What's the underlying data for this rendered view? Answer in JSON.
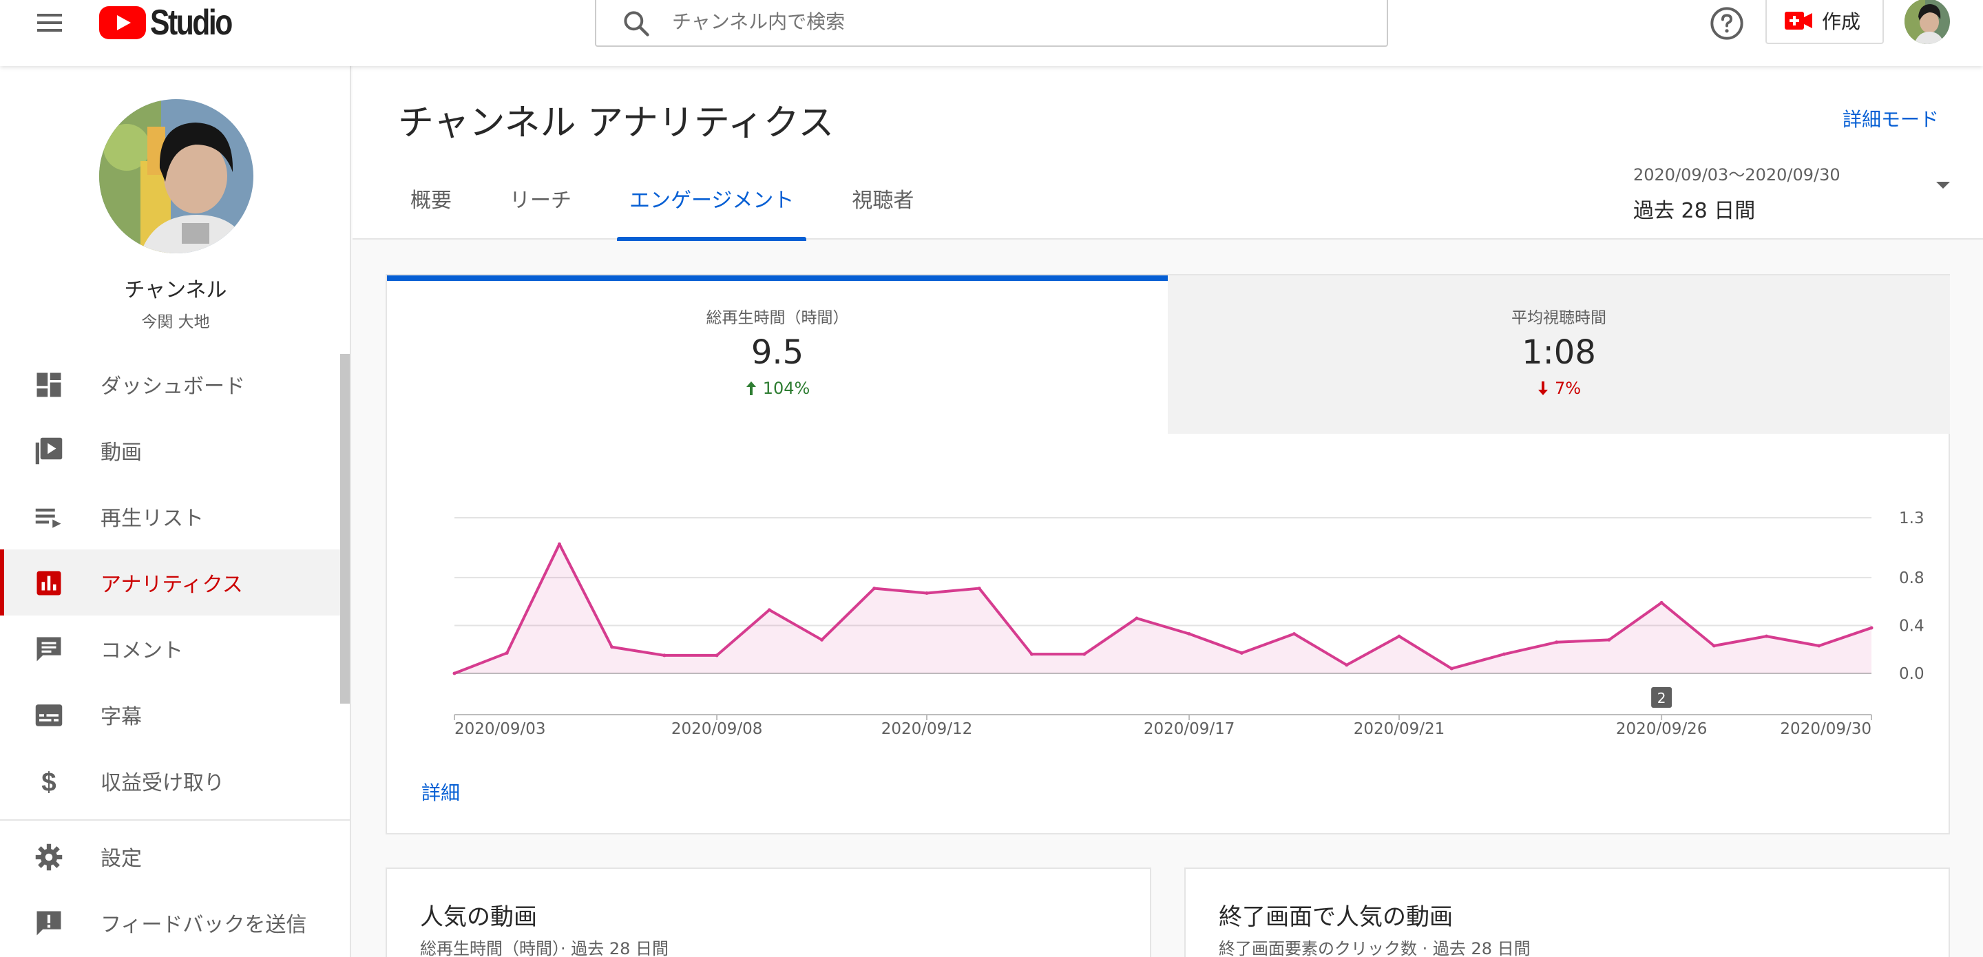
{
  "header": {
    "logo_text": "Studio",
    "search_placeholder": "チャンネル内で検索",
    "create_label": "作成"
  },
  "sidebar": {
    "channel_title": "チャンネル",
    "channel_owner": "今関 大地",
    "items": [
      {
        "label": "ダッシュボード",
        "icon": "dashboard-icon"
      },
      {
        "label": "動画",
        "icon": "video-icon"
      },
      {
        "label": "再生リスト",
        "icon": "playlist-icon"
      },
      {
        "label": "アナリティクス",
        "icon": "analytics-icon",
        "active": true
      },
      {
        "label": "コメント",
        "icon": "comment-icon"
      },
      {
        "label": "字幕",
        "icon": "subtitles-icon"
      },
      {
        "label": "収益受け取り",
        "icon": "dollar-icon"
      }
    ],
    "footer_items": [
      {
        "label": "設定",
        "icon": "gear-icon"
      },
      {
        "label": "フィードバックを送信",
        "icon": "feedback-icon"
      }
    ]
  },
  "main": {
    "title": "チャンネル アナリティクス",
    "advanced_mode": "詳細モード",
    "tabs": [
      {
        "label": "概要"
      },
      {
        "label": "リーチ"
      },
      {
        "label": "エンゲージメント",
        "active": true
      },
      {
        "label": "視聴者"
      }
    ],
    "date_range": "2020/09/03〜2020/09/30",
    "date_label": "過去 28 日間",
    "metrics": [
      {
        "label": "総再生時間（時間）",
        "value": "9.5",
        "change": "104%",
        "direction": "up"
      },
      {
        "label": "平均視聴時間",
        "value": "1:08",
        "change": "7%",
        "direction": "down"
      }
    ],
    "detail_link": "詳細",
    "bottom_cards": [
      {
        "title": "人気の動画",
        "subtitle": "総再生時間（時間）· 過去 28 日間"
      },
      {
        "title": "終了画面で人気の動画",
        "subtitle": "終了画面要素のクリック数 · 過去 28 日間"
      }
    ]
  },
  "colors": {
    "accent": "#065fd4",
    "brand_red": "#ff0000",
    "active_nav": "#cc0000",
    "chart_line": "#d63c8f",
    "up": "#2e7d32",
    "down": "#cc0000"
  },
  "chart_data": {
    "type": "area",
    "x": [
      "2020/09/03",
      "2020/09/04",
      "2020/09/05",
      "2020/09/06",
      "2020/09/07",
      "2020/09/08",
      "2020/09/09",
      "2020/09/10",
      "2020/09/11",
      "2020/09/12",
      "2020/09/13",
      "2020/09/14",
      "2020/09/15",
      "2020/09/16",
      "2020/09/17",
      "2020/09/18",
      "2020/09/19",
      "2020/09/20",
      "2020/09/21",
      "2020/09/22",
      "2020/09/23",
      "2020/09/24",
      "2020/09/25",
      "2020/09/26",
      "2020/09/27",
      "2020/09/28",
      "2020/09/29",
      "2020/09/30"
    ],
    "series": [
      {
        "values": [
          0.0,
          0.17,
          1.08,
          0.22,
          0.15,
          0.15,
          0.53,
          0.28,
          0.71,
          0.67,
          0.71,
          0.16,
          0.16,
          0.46,
          0.33,
          0.17,
          0.33,
          0.07,
          0.31,
          0.04,
          0.16,
          0.26,
          0.28,
          0.59,
          0.23,
          0.31,
          0.23,
          0.38
        ]
      }
    ],
    "x_tick_labels": [
      "2020/09/03",
      "2020/09/08",
      "2020/09/12",
      "2020/09/17",
      "2020/09/21",
      "2020/09/26",
      "2020/09/30"
    ],
    "y_ticks": [
      1.3,
      0.8,
      0.4,
      0.0
    ],
    "y_tick_labels": [
      "1.3",
      "0.8",
      "0.4",
      "0.0"
    ],
    "ylim": [
      0,
      1.3
    ],
    "grid": true,
    "y_axis_side": "right",
    "annotation": {
      "x": "2020/09/26",
      "label": "2"
    }
  }
}
